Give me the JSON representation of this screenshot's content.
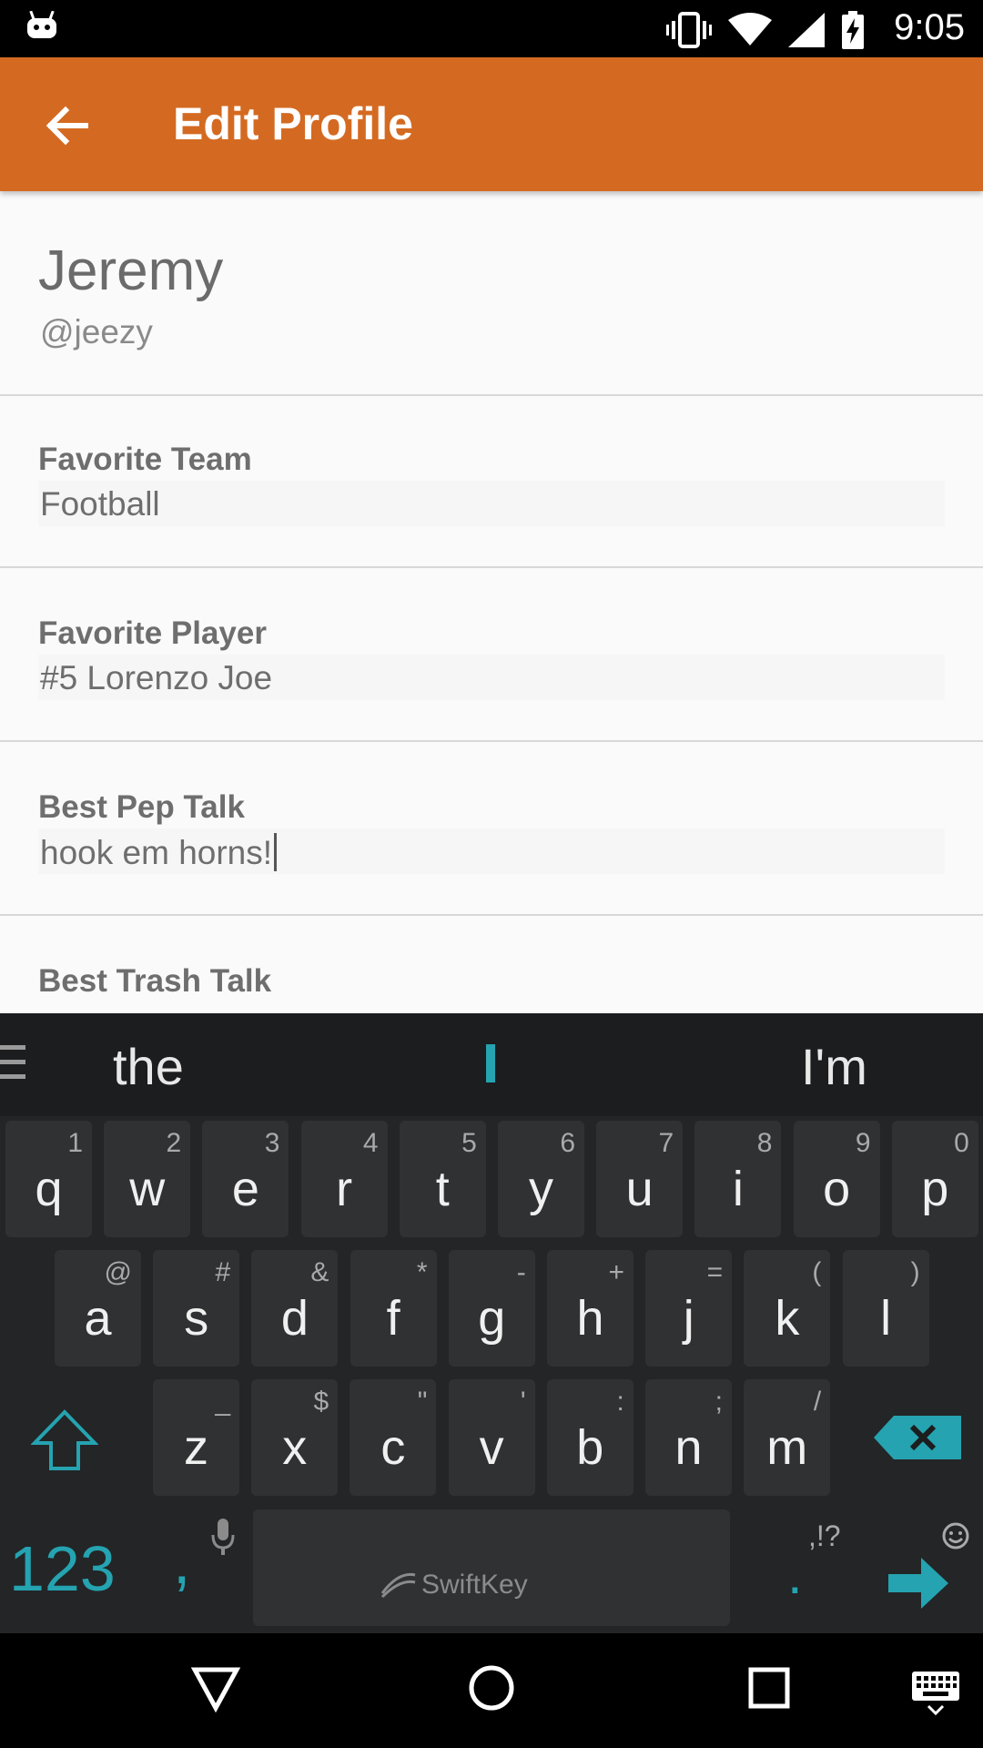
{
  "status_bar": {
    "time": "9:05",
    "icons": [
      "android-icon",
      "vibrate-icon",
      "wifi-icon",
      "signal-icon",
      "battery-charging-icon"
    ]
  },
  "app_bar": {
    "title": "Edit Profile",
    "back_icon": "arrow-left-icon",
    "color": "#d46a21"
  },
  "profile": {
    "name": "Jeremy",
    "handle": "@jeezy"
  },
  "fields": [
    {
      "label": "Favorite Team",
      "value": "Football"
    },
    {
      "label": "Favorite Player",
      "value": "#5 Lorenzo Joe"
    },
    {
      "label": "Best Pep Talk",
      "value": "hook em horns!"
    },
    {
      "label": "Best Trash Talk",
      "value": ""
    }
  ],
  "keyboard": {
    "suggestions": [
      "the",
      "",
      "I'm"
    ],
    "row1": [
      {
        "k": "q",
        "s": "1"
      },
      {
        "k": "w",
        "s": "2"
      },
      {
        "k": "e",
        "s": "3"
      },
      {
        "k": "r",
        "s": "4"
      },
      {
        "k": "t",
        "s": "5"
      },
      {
        "k": "y",
        "s": "6"
      },
      {
        "k": "u",
        "s": "7"
      },
      {
        "k": "i",
        "s": "8"
      },
      {
        "k": "o",
        "s": "9"
      },
      {
        "k": "p",
        "s": "0"
      }
    ],
    "row2": [
      {
        "k": "a",
        "s": "@"
      },
      {
        "k": "s",
        "s": "#"
      },
      {
        "k": "d",
        "s": "&"
      },
      {
        "k": "f",
        "s": "*"
      },
      {
        "k": "g",
        "s": "-"
      },
      {
        "k": "h",
        "s": "+"
      },
      {
        "k": "j",
        "s": "="
      },
      {
        "k": "k",
        "s": "("
      },
      {
        "k": "l",
        "s": ")"
      }
    ],
    "row3": [
      {
        "k": "z",
        "s": "_"
      },
      {
        "k": "x",
        "s": "$"
      },
      {
        "k": "c",
        "s": "\""
      },
      {
        "k": "v",
        "s": "'"
      },
      {
        "k": "b",
        "s": ":"
      },
      {
        "k": "n",
        "s": ";"
      },
      {
        "k": "m",
        "s": "/"
      }
    ],
    "numbers_key": "123",
    "comma_key": ",",
    "period_key": ".",
    "punct_hint": ",!?",
    "brand": "SwiftKey",
    "accent": "#25a3b0"
  },
  "nav_bar": {
    "icons": [
      "back-triangle-icon",
      "home-circle-icon",
      "recents-square-icon",
      "keyboard-icon"
    ]
  }
}
